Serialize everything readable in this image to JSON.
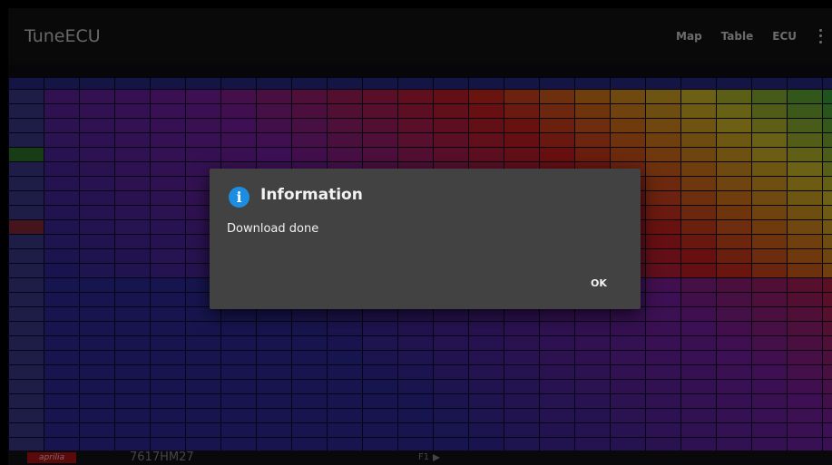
{
  "app": {
    "title": "TuneECU",
    "actions": [
      {
        "label": "Map"
      },
      {
        "label": "Table"
      },
      {
        "label": "ECU"
      }
    ],
    "overflow_icon": "more-vert-icon"
  },
  "dialog": {
    "icon": "info-icon",
    "icon_glyph": "i",
    "title": "Information",
    "message": "Download done",
    "ok_label": "OK"
  },
  "statusbar": {
    "brand": "aprilia",
    "ecu_id": "7617HM27",
    "page": "F1",
    "next_icon": "play-arrow-icon"
  },
  "map": {
    "rows_visible": 26,
    "cols_visible": 23,
    "colors": {
      "low": "#2d2a9e",
      "mid": "#7c1fa8",
      "high": "#d01f1f",
      "peak_orange": "#e07a1a",
      "peak_yellow": "#d9c42a",
      "peak_green": "#3aa63a"
    }
  }
}
